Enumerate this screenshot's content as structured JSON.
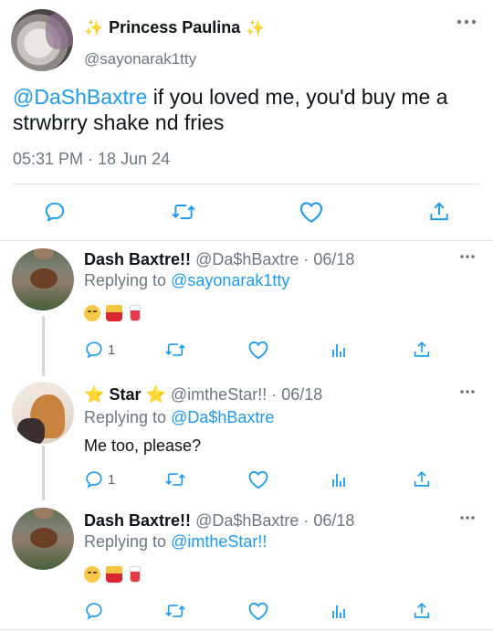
{
  "main_tweet": {
    "author_name": "Princess Paulina",
    "sparkle_left": "✨",
    "sparkle_right": "✨",
    "handle": "@sayonarak1tty",
    "mention": "@DaShBaxtre",
    "text": " if you loved me, you'd buy me a strwbrry shake nd fries",
    "time": "05:31 PM · 18 Jun 24",
    "more_icon": "more-horizontal-icon",
    "actions": [
      "reply-icon",
      "retweet-icon",
      "like-icon",
      "share-icon"
    ]
  },
  "replies": [
    {
      "name": "Dash Baxtre!!",
      "handle_date": "@Da$hBaxtre · 06/18",
      "replying_prefix": "Replying to ",
      "replying_to": "@sayonarak1tty",
      "emojis": [
        "pensive-face",
        "french-fries",
        "cup-with-straw"
      ],
      "reply_count": "1"
    },
    {
      "name": "Star",
      "star_left": "⭐",
      "star_right": "⭐",
      "handle_date": "@imtheStar!! · 06/18",
      "replying_prefix": "Replying to ",
      "replying_to": "@Da$hBaxtre",
      "text": "Me too, please?",
      "reply_count": "1"
    },
    {
      "name": "Dash Baxtre!!",
      "handle_date": "@Da$hBaxtre · 06/18",
      "replying_prefix": "Replying to ",
      "replying_to": "@imtheStar!!",
      "emojis": [
        "rolling-eyes-face",
        "french-fries",
        "cup-with-straw"
      ]
    }
  ],
  "colors": {
    "link_blue": "#1d9bf0",
    "meta_grey": "#6e7781",
    "sparkle": "#f5c518"
  }
}
